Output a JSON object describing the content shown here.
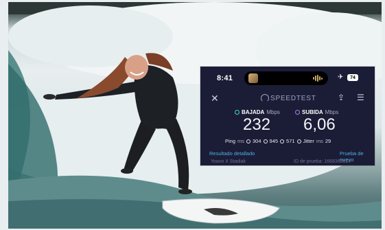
{
  "speedtest": {
    "time": "8:41",
    "battery": "74",
    "brand": "SPEEDTEST",
    "download_label": "BAJADA",
    "upload_label": "SUBIDA",
    "unit": "Mbps",
    "download_value": "232",
    "upload_value": "6,06",
    "ping_label": "Ping",
    "ping_unit": "ms",
    "ping_idle": "304",
    "ping_download": "945",
    "ping_upload": "571",
    "jitter_label": "Jitter",
    "jitter_unit": "ms",
    "jitter_value": "29",
    "detail_link": "Resultado detallado",
    "retry_link": "Prueba de nuevo",
    "bottom_left": "Yoavo X Stadiak",
    "bottom_right": "ID de prueba: 1668363614"
  },
  "colors": {
    "card_bg": "#1b1d37",
    "download_accent": "#3fd6c8",
    "upload_accent": "#b57af0",
    "link": "#4fb0e8"
  },
  "icons": [
    "close-icon",
    "speedtest-logo-icon",
    "share-icon",
    "menu-icon",
    "airplane-icon",
    "battery-icon"
  ]
}
